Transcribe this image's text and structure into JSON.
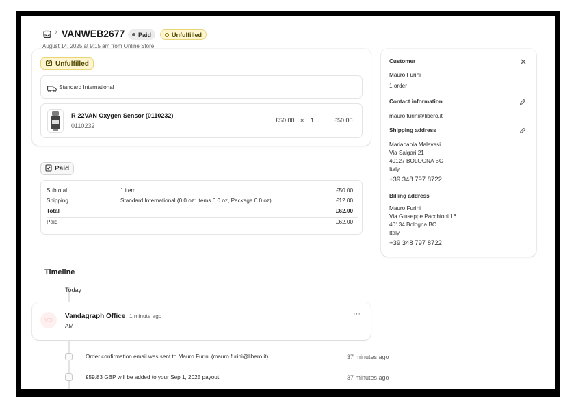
{
  "order": {
    "number": "VANWEB2677",
    "paid_badge": "Paid",
    "fulfillment_badge": "Unfulfilled",
    "subtitle": "August 14, 2025 at 9:15 am from Online Store"
  },
  "fulfillment_card": {
    "status_label": "Unfulfilled",
    "shipping_method": "Standard International",
    "line_item": {
      "title": "R-22VAN Oxygen Sensor (0110232)",
      "sku": "0110232",
      "unit_price": "£50.00",
      "times": "×",
      "quantity": "1",
      "total": "£50.00"
    }
  },
  "payment_card": {
    "status_label": "Paid",
    "rows": [
      {
        "label": "Subtotal",
        "detail": "1 item",
        "amount": "£50.00"
      },
      {
        "label": "Shipping",
        "detail": "Standard International (0.0 oz: Items 0.0 oz, Package 0.0 oz)",
        "amount": "£12.00"
      },
      {
        "label": "Total",
        "detail": "",
        "amount": "£62.00"
      },
      {
        "label": "Paid",
        "detail": "",
        "amount": "£62.00"
      }
    ]
  },
  "timeline": {
    "title": "Timeline",
    "today_label": "Today",
    "comment": {
      "author": "Vandagraph Office",
      "time": "1 minute ago",
      "body": "AM",
      "more": "···"
    },
    "events": [
      {
        "text": "Order confirmation email was sent to Mauro Furini (mauro.furini@libero.it).",
        "time": "37 minutes ago"
      },
      {
        "text": "£59.83 GBP will be added to your Sep 1, 2025 payout.",
        "time": "37 minutes ago"
      }
    ]
  },
  "customer": {
    "heading": "Customer",
    "name": "Mauro Furini",
    "orders": "1 order",
    "contact_heading": "Contact information",
    "email": "mauro.furini@libero.it",
    "shipping_heading": "Shipping address",
    "shipping_lines": [
      "Mariapaola Malavasi",
      "Via Salgari 21",
      "40127 BOLOGNA BO",
      "Italy"
    ],
    "shipping_phone": "+39 348 797 8722",
    "billing_heading": "Billing address",
    "billing_lines": [
      "Mauro Furini",
      "Via Giuseppe Pacchioni 16",
      "40134 Bologna BO",
      "Italy"
    ],
    "billing_phone": "+39 348 797 8722"
  },
  "colors": {
    "unfulfilled_bg": "#fff5d1",
    "paid_bg": "#ececec"
  }
}
